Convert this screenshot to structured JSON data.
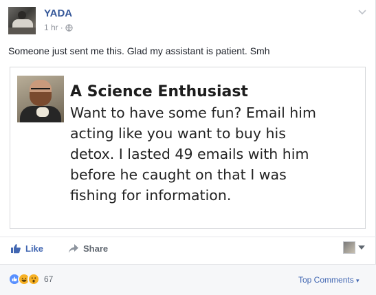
{
  "post": {
    "author": "YADA",
    "timestamp": "1 hr",
    "separator": "·",
    "privacy_icon": "globe-icon",
    "options_icon": "chevron-down-icon",
    "message": "Someone just sent me this. Glad my assistant is patient. Smh"
  },
  "attachment": {
    "title": "A Science Enthusiast",
    "lines": [
      "Want to have some fun? Email him",
      "acting like you want to buy his",
      "detox. I lasted 49 emails with him",
      "before he caught on that I was",
      "fishing for information."
    ]
  },
  "actions": {
    "like_label": "Like",
    "share_label": "Share",
    "like_icon": "thumbs-up-icon",
    "share_icon": "share-arrow-icon"
  },
  "footer": {
    "reaction_icons": [
      "like-reaction-icon",
      "haha-reaction-icon",
      "wow-reaction-icon"
    ],
    "reaction_count": "67",
    "top_comments_label": "Top Comments",
    "top_comments_caret": "▾"
  },
  "colors": {
    "link_blue": "#365899",
    "action_blue": "#4267b2",
    "muted_gray": "#90949c",
    "footer_bg": "#f6f7f9"
  }
}
